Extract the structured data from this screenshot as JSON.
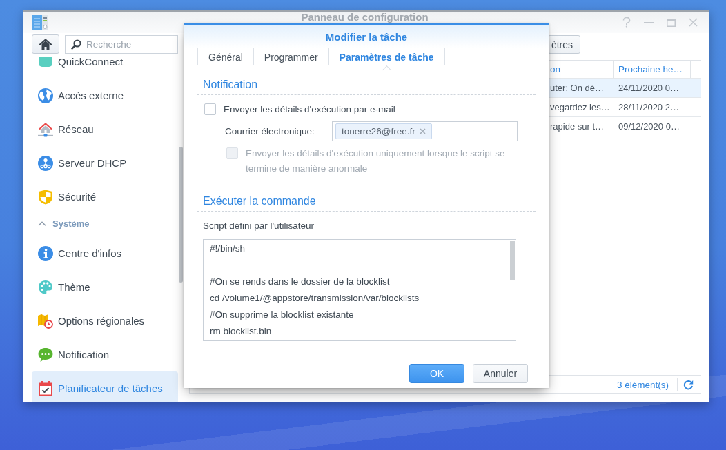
{
  "window": {
    "title": "Panneau de configuration"
  },
  "sidebar": {
    "search": {
      "placeholder": "Recherche"
    },
    "sections": [
      {
        "items": [
          {
            "label": "QuickConnect",
            "kind": "quickconnect",
            "selected": false
          },
          {
            "label": "Accès externe",
            "kind": "external",
            "selected": false
          },
          {
            "label": "Réseau",
            "kind": "network",
            "selected": false
          },
          {
            "label": "Serveur DHCP",
            "kind": "dhcp",
            "selected": false
          },
          {
            "label": "Sécurité",
            "kind": "security",
            "selected": false
          }
        ]
      },
      {
        "title": "Système",
        "expanded": true,
        "items": [
          {
            "label": "Centre d'infos",
            "kind": "info",
            "selected": false
          },
          {
            "label": "Thème",
            "kind": "theme",
            "selected": false
          },
          {
            "label": "Options régionales",
            "kind": "regional",
            "selected": false
          },
          {
            "label": "Notification",
            "kind": "notification",
            "selected": false
          },
          {
            "label": "Planificateur de tâches",
            "kind": "scheduler",
            "selected": true
          }
        ]
      }
    ]
  },
  "toolbar": {
    "button": "ètres"
  },
  "table": {
    "columns": [
      "on",
      "Prochaine he…"
    ],
    "rows": [
      {
        "cells": [
          "uter: On dé…",
          "24/11/2020 0…"
        ],
        "selected": true
      },
      {
        "cells": [
          "vegardez les…",
          "28/11/2020 2…"
        ],
        "selected": false
      },
      {
        "cells": [
          "rapide sur t…",
          "09/12/2020 0…"
        ],
        "selected": false
      }
    ]
  },
  "status_bar": {
    "count": "3 élément(s)"
  },
  "dialog": {
    "title": "Modifier la tâche",
    "tabs": [
      {
        "label": "Général",
        "selected": false
      },
      {
        "label": "Programmer",
        "selected": false
      },
      {
        "label": "Paramètres de tâche",
        "selected": true
      }
    ],
    "sections": [
      {
        "title": "Notification",
        "rows": [
          {
            "kind": "checkbox",
            "label": "Envoyer les détails d'exécution par e-mail",
            "checked": false,
            "disabled": false,
            "children": [
              {
                "kind": "tags",
                "label": "Courrier électronique:",
                "tags": [
                  "tonerre26@free.fr"
                ]
              },
              {
                "kind": "checkbox",
                "label": "Envoyer les détails d'exécution uniquement lorsque le script se termine de manière anormale",
                "checked": false,
                "disabled": true
              }
            ]
          }
        ]
      },
      {
        "title": "Exécuter la commande",
        "rows": [
          {
            "kind": "caption",
            "label": "Script défini par l'utilisateur"
          },
          {
            "kind": "script",
            "value": "#!/bin/sh\n\n#On se rends dans le dossier de la blocklist\ncd /volume1/@appstore/transmission/var/blocklists\n#On supprime la blocklist existante\nrm blocklist.bin"
          }
        ]
      }
    ],
    "buttons": [
      {
        "label": "OK",
        "kind": "primary"
      },
      {
        "label": "Annuler",
        "kind": "secondary"
      }
    ]
  }
}
